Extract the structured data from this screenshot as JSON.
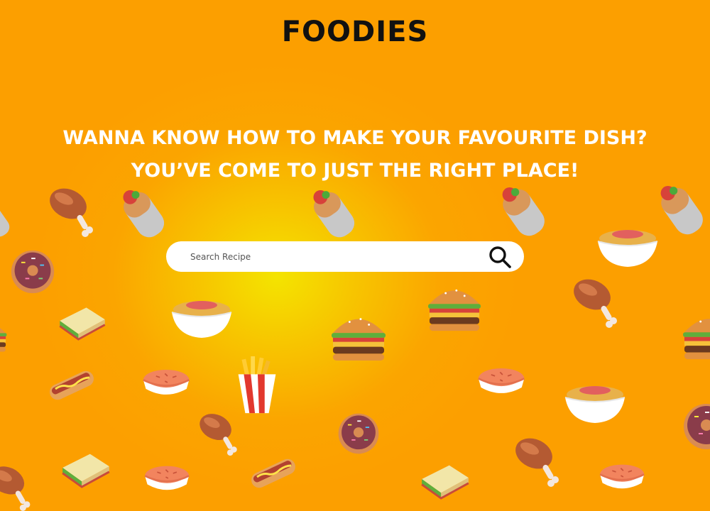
{
  "header": {
    "brand": "FOODIES"
  },
  "hero": {
    "headline": "WANNA KNOW HOW TO MAKE YOUR FAVOURITE DISH? YOU’VE COME TO JUST THE RIGHT PLACE!"
  },
  "search": {
    "placeholder": "Search Recipe",
    "value": "",
    "icon": "search-icon"
  },
  "colors": {
    "background": "#fc9f00",
    "glow": "#f4e400",
    "headline": "#ffffff",
    "brand": "#111111"
  },
  "decorations": [
    "chicken-drumstick",
    "burrito",
    "donut",
    "noodle-bowl",
    "sandwich",
    "burger",
    "hot-dog",
    "pie",
    "french-fries"
  ]
}
